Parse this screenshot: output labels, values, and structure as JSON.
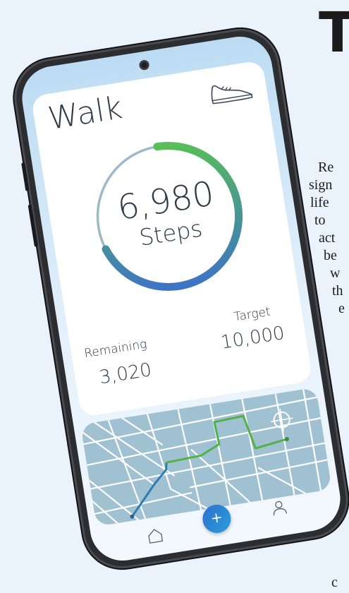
{
  "app": {
    "title": "Walk",
    "steps_value": "6,980",
    "steps_unit": "Steps",
    "progress_fraction": 0.698,
    "remaining_label": "Remaining",
    "remaining_value": "3,020",
    "target_label": "Target",
    "target_value": "10,000"
  },
  "icons": {
    "activity": "shoe-icon",
    "home": "home-icon",
    "add": "plus-icon",
    "profile": "person-icon",
    "camera": "camera-icon"
  },
  "nav": {
    "add_label": "+"
  },
  "colors": {
    "ring_start": "#57bf57",
    "ring_end": "#3e74c4",
    "ring_track": "#9fb9c8",
    "route_green": "#54b049",
    "route_blue": "#2f7bb2",
    "map_bg": "#9fc1d2"
  },
  "background_text": {
    "heading": "T",
    "lines": [
      "Re",
      "sign",
      "life",
      "to",
      "act",
      "be",
      "w",
      "th",
      "e"
    ],
    "bottom_fragment": "c"
  }
}
